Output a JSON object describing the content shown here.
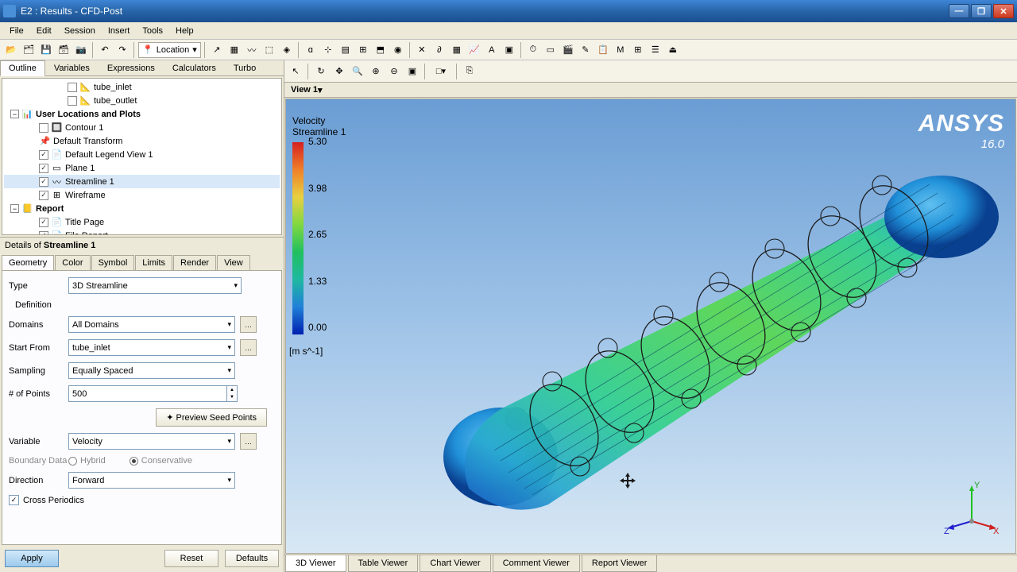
{
  "window": {
    "title": "E2 : Results - CFD-Post"
  },
  "menu": [
    "File",
    "Edit",
    "Session",
    "Insert",
    "Tools",
    "Help"
  ],
  "toolbar": {
    "location_label": "Location"
  },
  "outline": {
    "tabs": [
      "Outline",
      "Variables",
      "Expressions",
      "Calculators",
      "Turbo"
    ],
    "active": 0,
    "items": [
      {
        "indent": 80,
        "chk": false,
        "icon": "📐",
        "label": "tube_inlet"
      },
      {
        "indent": 80,
        "chk": false,
        "icon": "📐",
        "label": "tube_outlet"
      },
      {
        "indent": 8,
        "expand": "−",
        "bold": true,
        "icon": "📊",
        "label": "User Locations and Plots"
      },
      {
        "indent": 44,
        "chk": false,
        "icon": "🔲",
        "label": "Contour 1"
      },
      {
        "indent": 44,
        "icon": "📌",
        "label": "Default Transform"
      },
      {
        "indent": 44,
        "chk": true,
        "icon": "📄",
        "label": "Default Legend View 1"
      },
      {
        "indent": 44,
        "chk": true,
        "icon": "▭",
        "label": "Plane 1"
      },
      {
        "indent": 44,
        "chk": true,
        "icon": "〰",
        "label": "Streamline 1",
        "sel": true
      },
      {
        "indent": 44,
        "chk": true,
        "icon": "⊞",
        "label": "Wireframe"
      },
      {
        "indent": 8,
        "expand": "−",
        "bold": true,
        "icon": "📒",
        "label": "Report"
      },
      {
        "indent": 44,
        "chk": true,
        "icon": "📄",
        "label": "Title Page"
      },
      {
        "indent": 44,
        "chk": true,
        "icon": "📄",
        "label": "File Report"
      }
    ]
  },
  "details": {
    "header_prefix": "Details of ",
    "header_item": "Streamline 1",
    "tabs": [
      "Geometry",
      "Color",
      "Symbol",
      "Limits",
      "Render",
      "View"
    ],
    "active": 0,
    "type_label": "Type",
    "type_value": "3D Streamline",
    "definition": "Definition",
    "domains_label": "Domains",
    "domains_value": "All Domains",
    "startfrom_label": "Start From",
    "startfrom_value": "tube_inlet",
    "sampling_label": "Sampling",
    "sampling_value": "Equally Spaced",
    "points_label": "# of Points",
    "points_value": "500",
    "preview_label": "Preview Seed Points",
    "variable_label": "Variable",
    "variable_value": "Velocity",
    "boundary_label": "Boundary Data",
    "hybrid": "Hybrid",
    "conservative": "Conservative",
    "direction_label": "Direction",
    "direction_value": "Forward",
    "cross_label": "Cross Periodics",
    "apply": "Apply",
    "reset": "Reset",
    "defaults": "Defaults"
  },
  "viewer": {
    "view_label": "View 1",
    "legend": {
      "title1": "Velocity",
      "title2": "Streamline 1",
      "ticks": [
        "5.30",
        "3.98",
        "2.65",
        "1.33",
        "0.00"
      ],
      "unit": "[m s^-1]"
    },
    "brand": {
      "name": "ANSYS",
      "version": "16.0"
    },
    "axes": {
      "x": "X",
      "y": "Y",
      "z": "Z"
    },
    "tabs": [
      "3D Viewer",
      "Table Viewer",
      "Chart Viewer",
      "Comment Viewer",
      "Report Viewer"
    ],
    "active": 0
  }
}
